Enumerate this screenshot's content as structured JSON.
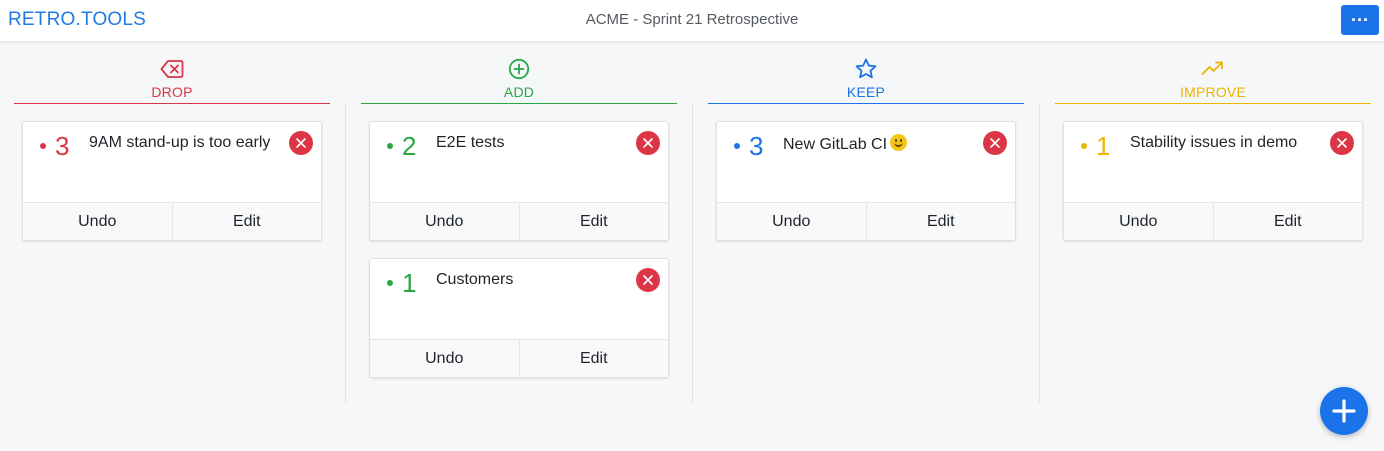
{
  "app": {
    "brand": "RETRO.TOOLS",
    "board_title": "ACME - Sprint 21 Retrospective",
    "menu_label": "···"
  },
  "columns": [
    {
      "label": "DROP",
      "icon": "backspace-icon",
      "color": "#dc3545",
      "cards": [
        {
          "votes": "3",
          "text": "9AM stand-up is too early",
          "undo": "Undo",
          "edit": "Edit"
        }
      ]
    },
    {
      "label": "ADD",
      "icon": "plus-circle-icon",
      "color": "#28a745",
      "cards": [
        {
          "votes": "2",
          "text": "E2E tests",
          "undo": "Undo",
          "edit": "Edit"
        },
        {
          "votes": "1",
          "text": "Customers",
          "undo": "Undo",
          "edit": "Edit"
        }
      ]
    },
    {
      "label": "KEEP",
      "icon": "star-icon",
      "color": "#1a73e8",
      "cards": [
        {
          "votes": "3",
          "text": "New GitLab CI",
          "emoji": "slightly-smiling-face-icon",
          "undo": "Undo",
          "edit": "Edit"
        }
      ]
    },
    {
      "label": "IMPROVE",
      "icon": "trending-up-icon",
      "color": "#f0b400",
      "cards": [
        {
          "votes": "1",
          "text": "Stability issues in demo",
          "undo": "Undo",
          "edit": "Edit"
        }
      ]
    }
  ],
  "fab": {
    "icon": "plus-icon"
  }
}
